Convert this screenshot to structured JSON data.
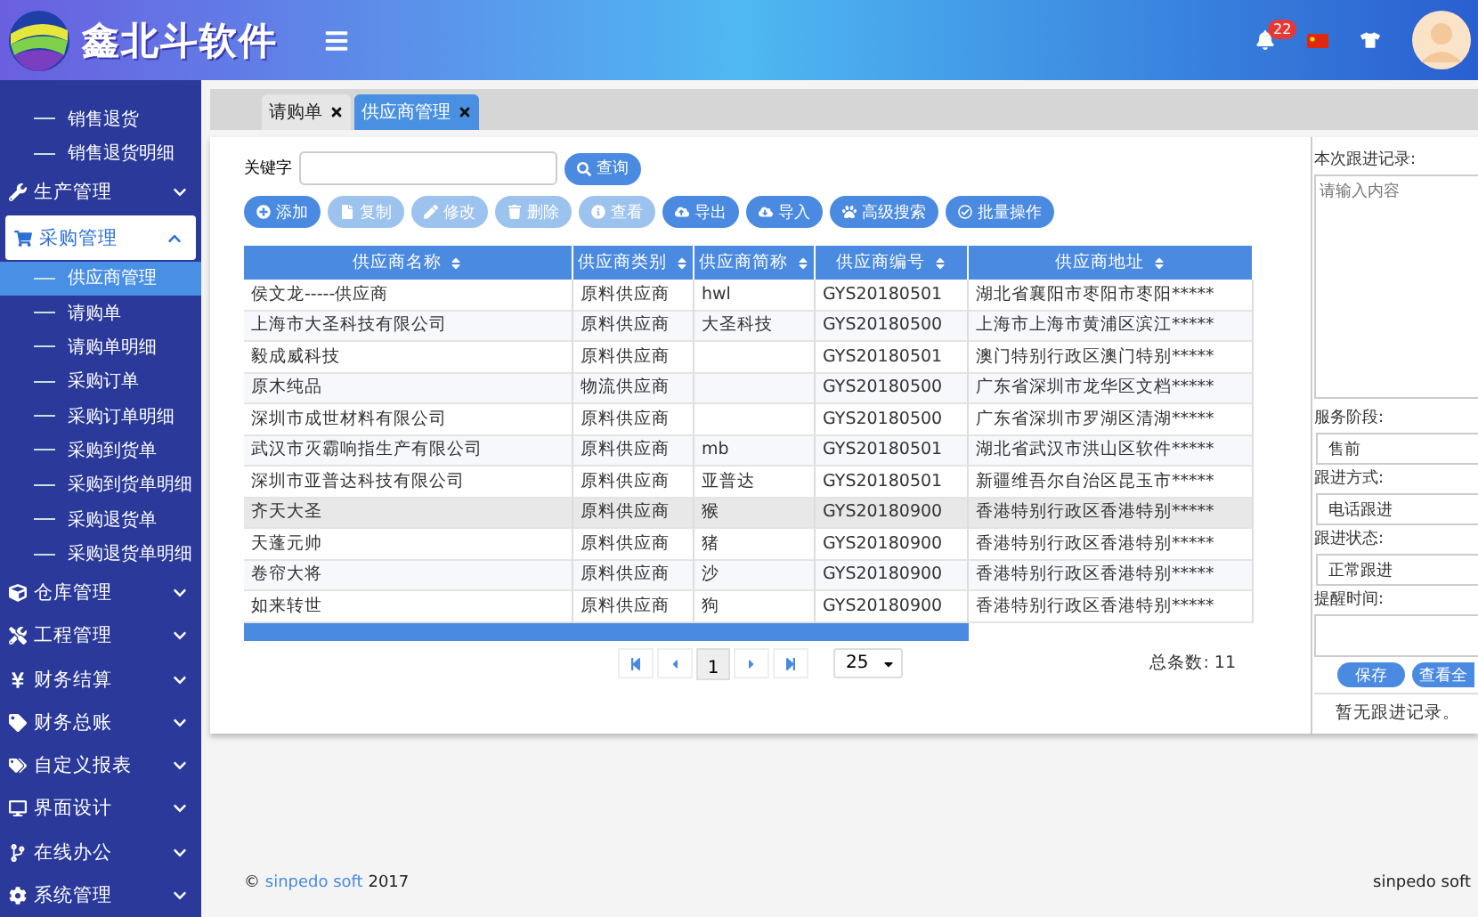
{
  "header": {
    "brand": "鑫北斗软件",
    "notification_count": "22"
  },
  "sidebar": {
    "leading_items": [
      {
        "label": "销售退货",
        "selected": false
      },
      {
        "label": "销售退货明细",
        "selected": false
      }
    ],
    "groups": [
      {
        "label": "生产管理",
        "expanded": false
      },
      {
        "label": "采购管理",
        "expanded": true,
        "children": [
          {
            "label": "供应商管理",
            "selected": true
          },
          {
            "label": "请购单",
            "selected": false
          },
          {
            "label": "请购单明细",
            "selected": false
          },
          {
            "label": "采购订单",
            "selected": false
          },
          {
            "label": "采购订单明细",
            "selected": false
          },
          {
            "label": "采购到货单",
            "selected": false
          },
          {
            "label": "采购到货单明细",
            "selected": false
          },
          {
            "label": "采购退货单",
            "selected": false
          },
          {
            "label": "采购退货单明细",
            "selected": false
          }
        ]
      },
      {
        "label": "仓库管理",
        "expanded": false
      },
      {
        "label": "工程管理",
        "expanded": false
      },
      {
        "label": "财务结算",
        "expanded": false
      },
      {
        "label": "财务总账",
        "expanded": false
      },
      {
        "label": "自定义报表",
        "expanded": false
      },
      {
        "label": "界面设计",
        "expanded": false
      },
      {
        "label": "在线办公",
        "expanded": false
      },
      {
        "label": "系统管理",
        "expanded": false
      }
    ]
  },
  "tabs": [
    {
      "label": "请购单",
      "selected": false
    },
    {
      "label": "供应商管理",
      "selected": true
    }
  ],
  "search": {
    "label": "关键字",
    "button": "查询"
  },
  "toolbar": [
    {
      "label": "添加",
      "disabled": false
    },
    {
      "label": "复制",
      "disabled": true
    },
    {
      "label": "修改",
      "disabled": true
    },
    {
      "label": "删除",
      "disabled": true
    },
    {
      "label": "查看",
      "disabled": true
    },
    {
      "label": "导出",
      "disabled": false
    },
    {
      "label": "导入",
      "disabled": false
    },
    {
      "label": "高级搜索",
      "disabled": false
    },
    {
      "label": "批量操作",
      "disabled": false
    }
  ],
  "table": {
    "columns": [
      "供应商名称",
      "供应商类别",
      "供应商简称",
      "供应商编号",
      "供应商地址"
    ],
    "rows": [
      {
        "cells": [
          "侯文龙-----供应商",
          "原料供应商",
          "hwl",
          "GYS20180501",
          "湖北省襄阳市枣阳市枣阳*****"
        ],
        "selected": false
      },
      {
        "cells": [
          "上海市大圣科技有限公司",
          "原料供应商",
          "大圣科技",
          "GYS20180500",
          "上海市上海市黄浦区滨江*****"
        ],
        "selected": false
      },
      {
        "cells": [
          "毅成威科技",
          "原料供应商",
          "",
          "GYS20180501",
          "澳门特别行政区澳门特别*****"
        ],
        "selected": false
      },
      {
        "cells": [
          "原木纯品",
          "物流供应商",
          "",
          "GYS20180500",
          "广东省深圳市龙华区文档*****"
        ],
        "selected": false
      },
      {
        "cells": [
          "深圳市成世材料有限公司",
          "原料供应商",
          "",
          "GYS20180500",
          "广东省深圳市罗湖区清湖*****"
        ],
        "selected": false
      },
      {
        "cells": [
          "武汉市灭霸响指生产有限公司",
          "原料供应商",
          "mb",
          "GYS20180501",
          "湖北省武汉市洪山区软件*****"
        ],
        "selected": false
      },
      {
        "cells": [
          "深圳市亚普达科技有限公司",
          "原料供应商",
          "亚普达",
          "GYS20180501",
          "新疆维吾尔自治区昆玉市*****"
        ],
        "selected": false
      },
      {
        "cells": [
          "齐天大圣",
          "原料供应商",
          "猴",
          "GYS20180900",
          "香港特别行政区香港特别*****"
        ],
        "selected": true
      },
      {
        "cells": [
          "天蓬元帅",
          "原料供应商",
          "猪",
          "GYS20180900",
          "香港特别行政区香港特别*****"
        ],
        "selected": false
      },
      {
        "cells": [
          "卷帘大将",
          "原料供应商",
          "沙",
          "GYS20180900",
          "香港特别行政区香港特别*****"
        ],
        "selected": false
      },
      {
        "cells": [
          "如来转世",
          "原料供应商",
          "狗",
          "GYS20180900",
          "香港特别行政区香港特别*****"
        ],
        "selected": false
      }
    ]
  },
  "pagination": {
    "page": "1",
    "page_size": "25",
    "total": "总条数: 11"
  },
  "followup": {
    "record_label": "本次跟进记录:",
    "record_placeholder": "请输入内容",
    "stage_label": "服务阶段:",
    "stage": "售前",
    "method_label": "跟进方式:",
    "method": "电话跟进",
    "status_label": "跟进状态:",
    "status": "正常跟进",
    "remind_label": "提醒时间:",
    "save": "保存",
    "view_all": "查看全",
    "empty": "暂无跟进记录。"
  },
  "footer": {
    "copyright": "©",
    "company": "sinpedo soft",
    "year": "2017",
    "right": "sinpedo soft"
  }
}
